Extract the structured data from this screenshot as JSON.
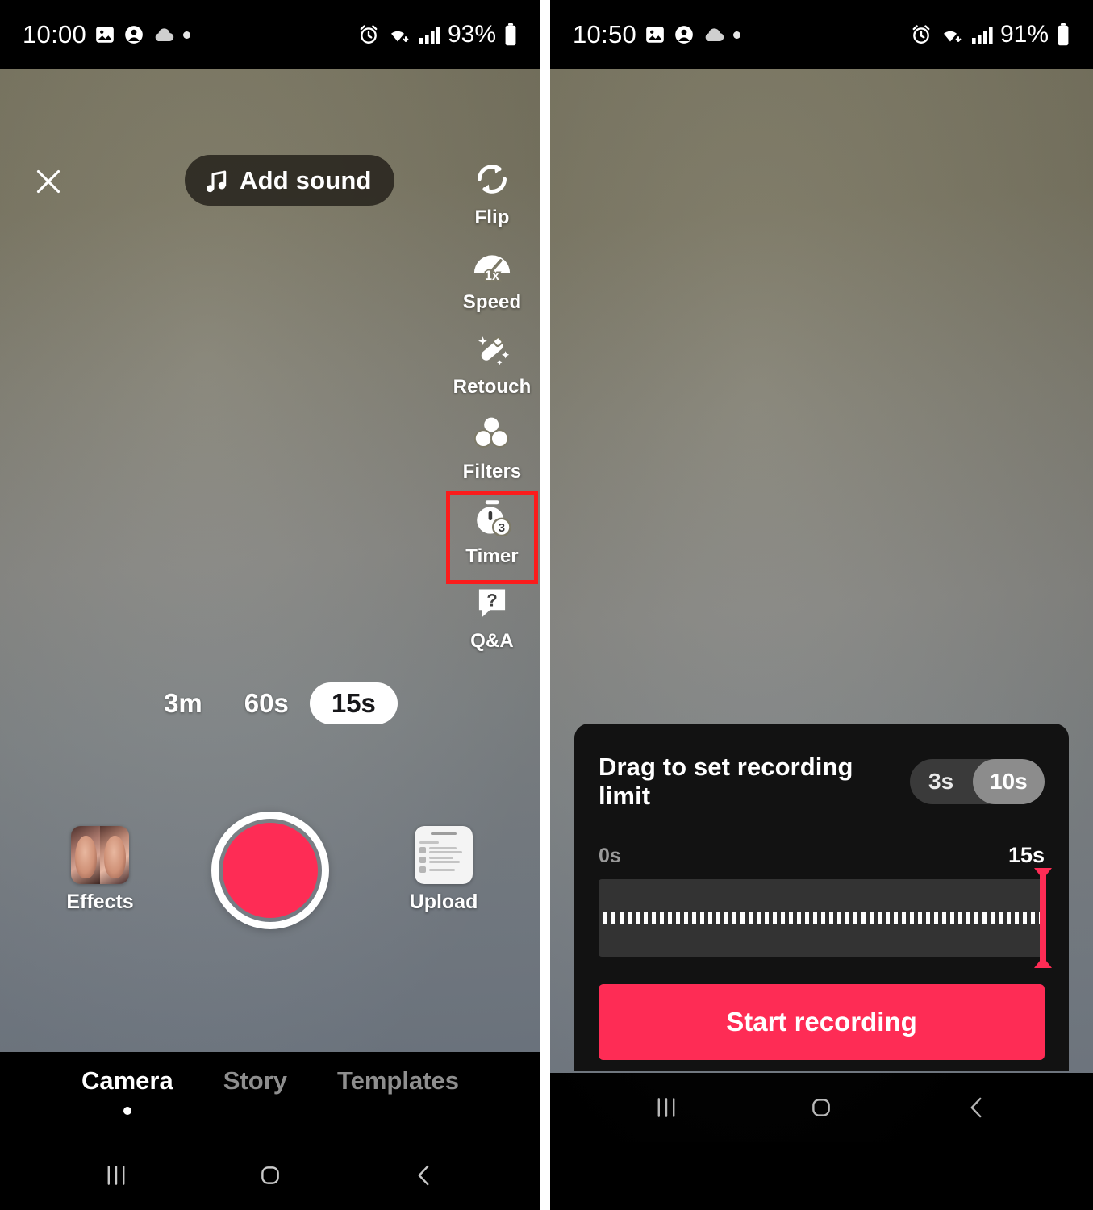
{
  "app": {
    "name": "TikTok Camera",
    "accent_color": "#fe2c55",
    "highlight_color": "#fb1c1c"
  },
  "left_phone": {
    "status_bar": {
      "time": "10:00",
      "battery_percent": "93%",
      "icons": [
        "image-icon",
        "contact-icon",
        "cloud-icon",
        "dot-icon",
        "alarm-icon",
        "wifi-icon",
        "signal-icon",
        "battery-icon"
      ]
    },
    "top_bar": {
      "close_label": "close-icon",
      "add_sound_label": "Add sound"
    },
    "tools": [
      {
        "label": "Flip",
        "icon": "flip-camera-icon",
        "highlighted": false
      },
      {
        "label": "Speed",
        "icon": "speed-gauge-icon",
        "badge": "1x",
        "highlighted": false
      },
      {
        "label": "Retouch",
        "icon": "retouch-wand-icon",
        "highlighted": false
      },
      {
        "label": "Filters",
        "icon": "filters-icon",
        "highlighted": false
      },
      {
        "label": "Timer",
        "icon": "timer-icon",
        "badge": "3",
        "highlighted": true
      },
      {
        "label": "Q&A",
        "icon": "qa-bubble-icon",
        "highlighted": false
      }
    ],
    "durations": [
      {
        "label": "3m",
        "active": false
      },
      {
        "label": "60s",
        "active": false
      },
      {
        "label": "15s",
        "active": true
      }
    ],
    "capture": {
      "record_label": "record-button",
      "effects_label": "Effects",
      "upload_label": "Upload"
    },
    "tabs": [
      {
        "label": "Camera",
        "active": true
      },
      {
        "label": "Story",
        "active": false
      },
      {
        "label": "Templates",
        "active": false
      }
    ]
  },
  "right_phone": {
    "status_bar": {
      "time": "10:50",
      "battery_percent": "91%"
    },
    "sheet": {
      "title": "Drag to set recording limit",
      "segments": [
        {
          "label": "3s",
          "active": false
        },
        {
          "label": "10s",
          "active": true
        }
      ],
      "range_min_label": "0s",
      "range_max_label": "15s",
      "slider_value_percent": 100,
      "start_button_label": "Start recording"
    }
  },
  "nav_bar": {
    "recents_label": "recents-icon",
    "home_label": "home-icon",
    "back_label": "back-icon"
  }
}
